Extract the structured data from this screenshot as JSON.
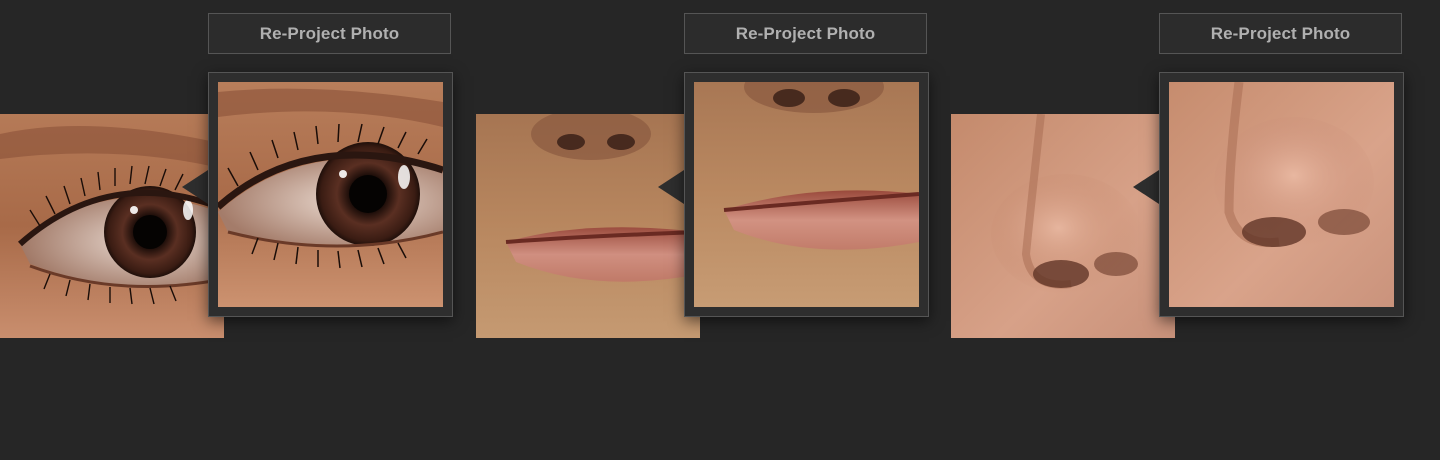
{
  "panels": [
    {
      "subject": "eye",
      "button_label": "Re-Project Photo",
      "icon": "pointer-arrow-icon"
    },
    {
      "subject": "mouth",
      "button_label": "Re-Project Photo",
      "icon": "pointer-arrow-icon"
    },
    {
      "subject": "nose",
      "button_label": "Re-Project Photo",
      "icon": "pointer-arrow-icon"
    }
  ],
  "colors": {
    "background": "#262626",
    "panel": "#2e2e2e",
    "border": "#555555",
    "label_text": "#b0b0b0"
  }
}
